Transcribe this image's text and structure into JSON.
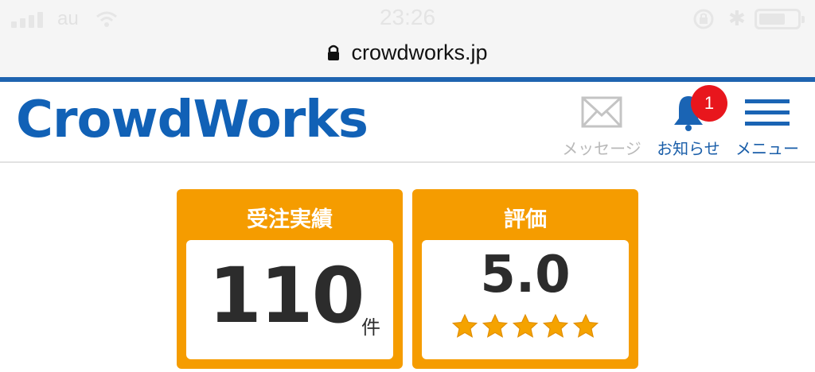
{
  "status_bar": {
    "carrier": "au",
    "time": "23:26",
    "signal_bars": 4,
    "icons": [
      "signal-icon",
      "wifi-icon",
      "rotation-lock-icon",
      "bluetooth-icon",
      "battery-icon"
    ]
  },
  "browser": {
    "url": "crowdworks.jp",
    "secure_icon": "lock-icon"
  },
  "header": {
    "logo_text": "CrowdWorks",
    "brand_color": "#1161b6",
    "nav": {
      "message_label": "メッセージ",
      "notice_label": "お知らせ",
      "notice_badge": "1",
      "menu_label": "メニュー"
    }
  },
  "stats": {
    "orders": {
      "title": "受注実績",
      "value": "110",
      "unit": "件"
    },
    "rating": {
      "title": "評価",
      "value": "5.0",
      "stars": 5,
      "max_stars": 5
    },
    "card_color": "#f59c00"
  }
}
